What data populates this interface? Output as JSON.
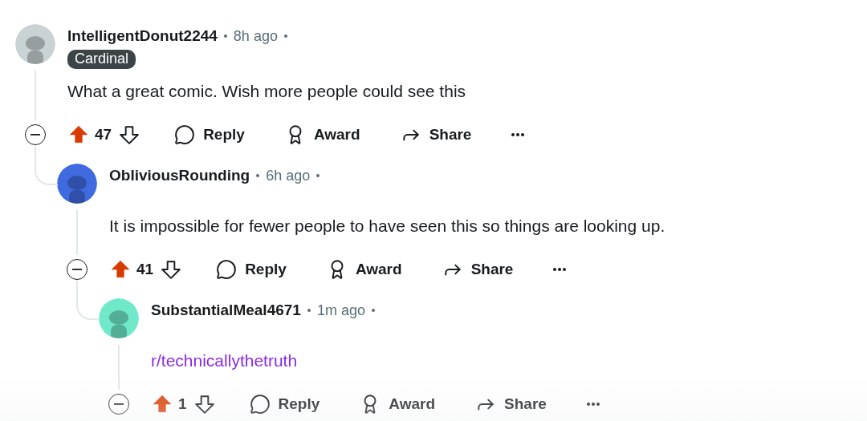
{
  "comments": [
    {
      "author": "IntelligentDonut2244",
      "time": "8h ago",
      "flair": "Cardinal",
      "avatar": {
        "color": "#c9d3d6"
      },
      "body": {
        "kind": "text",
        "text": "What a great comic. Wish more people could see this"
      },
      "upvoted": true,
      "score": "47",
      "actions": {
        "reply": "Reply",
        "award": "Award",
        "share": "Share"
      },
      "children": [
        {
          "author": "ObliviousRounding",
          "time": "6h ago",
          "avatar": {
            "color": "#3f6ae0"
          },
          "body": {
            "kind": "text",
            "text": "It is impossible for fewer people to have seen this so things are looking up."
          },
          "upvoted": true,
          "score": "41",
          "actions": {
            "reply": "Reply",
            "award": "Award",
            "share": "Share"
          },
          "children": [
            {
              "author": "SubstantialMeal4671",
              "time": "1m ago",
              "avatar": {
                "color": "#6fe9c9"
              },
              "body": {
                "kind": "link",
                "text": "r/technicallythetruth"
              },
              "upvoted": true,
              "score": "1",
              "actions": {
                "reply": "Reply",
                "award": "Award",
                "share": "Share"
              }
            }
          ]
        }
      ]
    }
  ]
}
